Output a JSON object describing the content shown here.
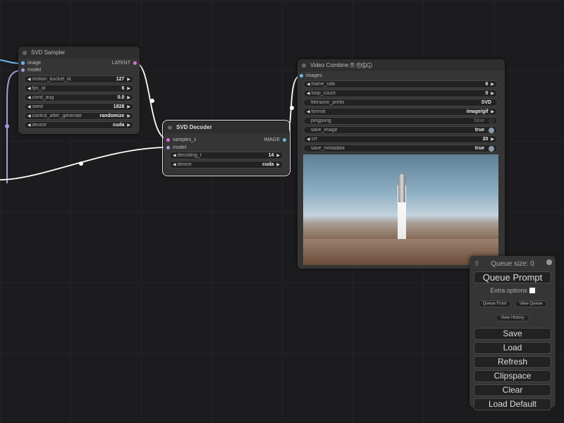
{
  "svd_sampler": {
    "title": "SVD Sampler",
    "inputs": [
      "image",
      "model"
    ],
    "output": "LATENT",
    "widgets": [
      {
        "label": "motion_bucket_id",
        "value": "127"
      },
      {
        "label": "fps_id",
        "value": "6"
      },
      {
        "label": "cond_aug",
        "value": "0.0"
      },
      {
        "label": "seed",
        "value": "1828"
      },
      {
        "label": "control_after_generate",
        "value": "randomize"
      },
      {
        "label": "device",
        "value": "cuda"
      }
    ]
  },
  "svd_decoder": {
    "title": "SVD Decoder",
    "inputs": [
      "samples_z",
      "model"
    ],
    "output": "IMAGE",
    "widgets": [
      {
        "label": "decoding_t",
        "value": "14"
      },
      {
        "label": "device",
        "value": "cuda"
      }
    ]
  },
  "video_combine": {
    "title": "Video Combine",
    "badge": "⎘ Ⓥⓗⓢ",
    "input": "images",
    "widgets": [
      {
        "label": "frame_rate",
        "value": "6",
        "type": "number"
      },
      {
        "label": "loop_count",
        "value": "0",
        "type": "number"
      },
      {
        "label": "filename_prefix",
        "value": "SVD",
        "type": "text"
      },
      {
        "label": "format",
        "value": "image/gif",
        "type": "combo"
      },
      {
        "label": "pingpong",
        "value": "false",
        "type": "toggle"
      },
      {
        "label": "save_image",
        "value": "true",
        "type": "toggle"
      },
      {
        "label": "crf",
        "value": "20",
        "type": "number"
      },
      {
        "label": "save_metadata",
        "value": "true",
        "type": "toggle"
      }
    ]
  },
  "queue": {
    "size_label": "Queue size: 0",
    "queue_prompt": "Queue Prompt",
    "extra_options": "Extra options",
    "queue_front": "Queue Front",
    "view_queue": "View Queue",
    "view_history": "View History",
    "buttons": [
      "Save",
      "Load",
      "Refresh",
      "Clipspace",
      "Clear",
      "Load Default"
    ]
  },
  "colors": {
    "image_link": "#6fb6e8",
    "model_link": "#a89ad8",
    "latent": "#e070e0",
    "link_white": "#ffffff"
  }
}
